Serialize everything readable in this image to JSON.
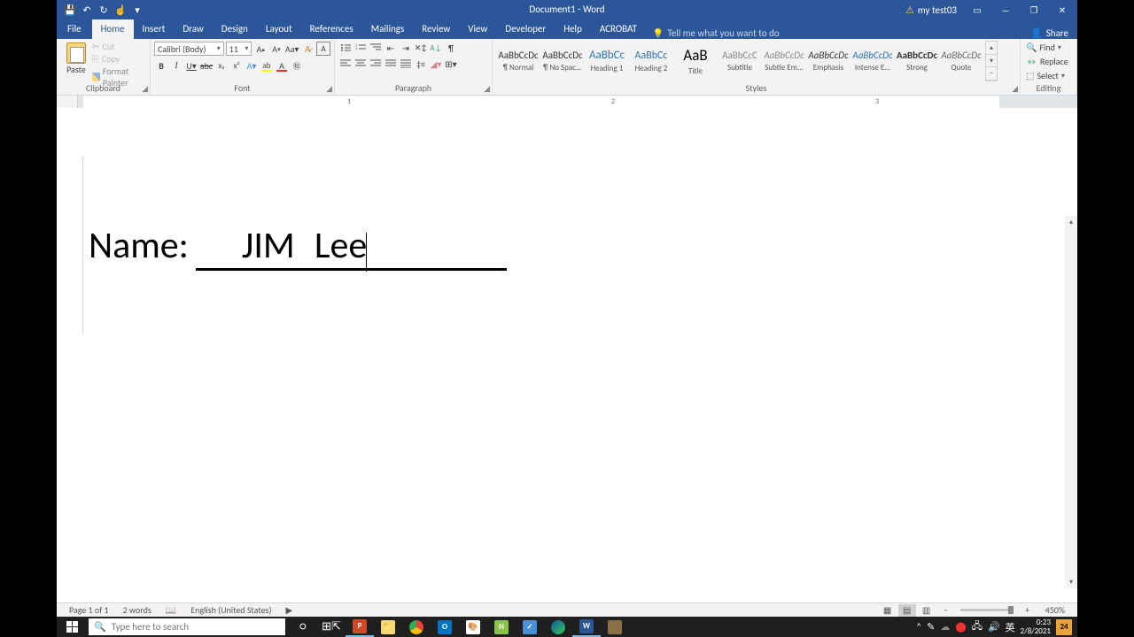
{
  "title": "Document1  -  Word",
  "user": "my test03",
  "qat": {
    "save": "💾",
    "undo": "↶",
    "redo": "↻",
    "touch": "☝"
  },
  "tabs": [
    "File",
    "Home",
    "Insert",
    "Draw",
    "Design",
    "Layout",
    "References",
    "Mailings",
    "Review",
    "View",
    "Developer",
    "Help",
    "ACROBAT"
  ],
  "active_tab": "Home",
  "tellme": "Tell me what you want to do",
  "share": "Share",
  "clipboard": {
    "label": "Clipboard",
    "paste": "Paste",
    "cut": "Cut",
    "copy": "Copy",
    "painter": "Format Painter"
  },
  "font": {
    "label": "Font",
    "name": "Calibri (Body)",
    "size": "11"
  },
  "paragraph": {
    "label": "Paragraph"
  },
  "styles": {
    "label": "Styles",
    "items": [
      {
        "prev": "AaBbCcDc",
        "name": "¶ Normal",
        "cls": ""
      },
      {
        "prev": "AaBbCcDc",
        "name": "¶ No Spac...",
        "cls": ""
      },
      {
        "prev": "AaBbCc",
        "name": "Heading 1",
        "cls": "h1"
      },
      {
        "prev": "AaBbCc",
        "name": "Heading 2",
        "cls": "h2"
      },
      {
        "prev": "AaB",
        "name": "Title",
        "cls": "ttl"
      },
      {
        "prev": "AaBbCcC",
        "name": "Subtitle",
        "cls": "subtl"
      },
      {
        "prev": "AaBbCcDc",
        "name": "Subtle Em...",
        "cls": "subem"
      },
      {
        "prev": "AaBbCcDc",
        "name": "Emphasis",
        "cls": "em"
      },
      {
        "prev": "AaBbCcDc",
        "name": "Intense E...",
        "cls": "intem"
      },
      {
        "prev": "AaBbCcDc",
        "name": "Strong",
        "cls": "strong"
      },
      {
        "prev": "AaBbCcDc",
        "name": "Quote",
        "cls": "quote"
      }
    ]
  },
  "editing": {
    "label": "Editing",
    "find": "Find",
    "replace": "Replace",
    "select": "Select"
  },
  "ruler_nums": [
    "1",
    "2",
    "3"
  ],
  "doc": {
    "label": "Name:",
    "value1": "JIM",
    "value2": "Lee"
  },
  "status": {
    "page": "Page 1 of 1",
    "words": "2 words",
    "lang": "English (United States)",
    "zoom": "450%"
  },
  "taskbar": {
    "search": "Type here to search",
    "ime": "英",
    "time": "0:23",
    "date": "2/8/2021",
    "notif": "24"
  }
}
